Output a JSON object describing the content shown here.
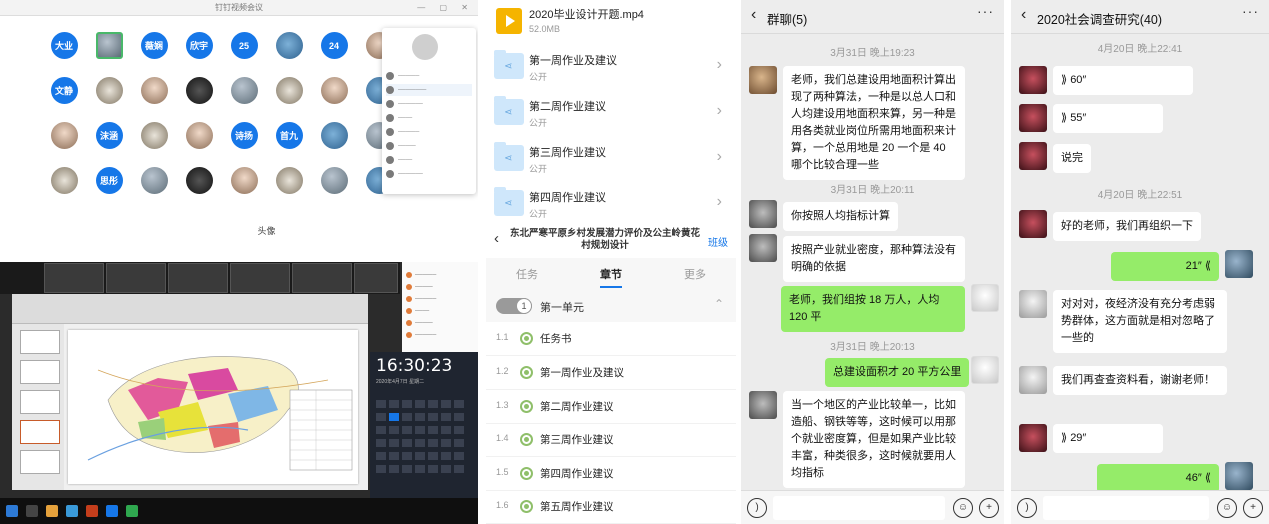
{
  "meeting": {
    "window_title": "钉钉视频会议",
    "attendees": [
      {
        "label": "大业",
        "type": "blue"
      },
      {
        "label": "",
        "type": "pic"
      },
      {
        "label": "薇娴",
        "type": "blue"
      },
      {
        "label": "欣宇",
        "type": "blue"
      },
      {
        "label": "25",
        "type": "blue"
      },
      {
        "label": "",
        "type": "pic3"
      },
      {
        "label": "24",
        "type": "blue"
      },
      {
        "label": "",
        "type": "pic2"
      },
      {
        "label": "文静",
        "type": "blue"
      },
      {
        "label": "",
        "type": "pic4"
      },
      {
        "label": "",
        "type": "pic2"
      },
      {
        "label": "",
        "type": "pic5"
      },
      {
        "label": "",
        "type": "pic"
      },
      {
        "label": "",
        "type": "pic4"
      },
      {
        "label": "",
        "type": "pic2"
      },
      {
        "label": "",
        "type": "pic3"
      },
      {
        "label": "",
        "type": "pic2"
      },
      {
        "label": "沫涵",
        "type": "blue"
      },
      {
        "label": "",
        "type": "pic4"
      },
      {
        "label": "",
        "type": "pic2"
      },
      {
        "label": "诗扬",
        "type": "blue"
      },
      {
        "label": "首九",
        "type": "blue"
      },
      {
        "label": "",
        "type": "pic3"
      },
      {
        "label": "",
        "type": "pic"
      },
      {
        "label": "",
        "type": "pic4"
      },
      {
        "label": "思彤",
        "type": "blue"
      },
      {
        "label": "",
        "type": "pic"
      },
      {
        "label": "",
        "type": "pic5"
      },
      {
        "label": "",
        "type": "pic2"
      },
      {
        "label": "",
        "type": "pic4"
      },
      {
        "label": "",
        "type": "pic"
      },
      {
        "label": "",
        "type": "pic3"
      },
      {
        "label": "头像",
        "type": "none"
      }
    ],
    "clock_time": "16:30:23",
    "clock_date": "2020年4月7日 星期二"
  },
  "course": {
    "video": {
      "name": "2020毕业设计开题.mp4",
      "size": "52.0MB"
    },
    "folders": [
      {
        "name": "第一周作业及建议",
        "status": "公开"
      },
      {
        "name": "第二周作业建议",
        "status": "公开"
      },
      {
        "name": "第三周作业建议",
        "status": "公开"
      },
      {
        "name": "第四周作业建议",
        "status": "公开"
      }
    ],
    "title": "东北严寒平原乡村发展潜力评价及公主岭黄花村规划设计",
    "class_button": "班级",
    "tabs": [
      "任务",
      "章节",
      "更多"
    ],
    "unit_number": "1",
    "unit_label": "第一单元",
    "chapters": [
      {
        "num": "1.1",
        "label": "任务书"
      },
      {
        "num": "1.2",
        "label": "第一周作业及建议"
      },
      {
        "num": "1.3",
        "label": "第二周作业建议"
      },
      {
        "num": "1.4",
        "label": "第三周作业建议"
      },
      {
        "num": "1.5",
        "label": "第四周作业建议"
      },
      {
        "num": "1.6",
        "label": "第五周作业建议"
      }
    ]
  },
  "chat1": {
    "title": "群聊(5)",
    "ts1": "3月31日 晚上19:23",
    "m1": "老师，我们总建设用地面积计算出现了两种算法，一种是以总人口和人均建设用地面积来算，另一种是用各类就业岗位所需用地面积来计算，一个总用地是 20 一个是 40 哪个比较合理一些",
    "ts2": "3月31日 晚上20:11",
    "m2": "你按照人均指标计算",
    "m3": "按照产业就业密度，那种算法没有明确的依据",
    "m4": "老师，我们组按 18 万人，人均 120 平",
    "ts3": "3月31日 晚上20:13",
    "m5": "总建设面积才 20 平方公里",
    "m6": "当一个地区的产业比较单一，比如造船、钢铁等等，这时候可以用那个就业密度算，但是如果产业比较丰富，种类很多，这时候就要用人均指标"
  },
  "chat2": {
    "title": "2020社会调查研究(40)",
    "ts1": "4月20日 晚上22:41",
    "v1": "60″",
    "v2": "55″",
    "m1": "说完",
    "ts2": "4月20日 晚上22:51",
    "m2": "好的老师，我们再组织一下",
    "v3": "21″",
    "m3": "对对对，夜经济没有充分考虑弱势群体，这方面就是相对忽略了一些的",
    "m4": "我们再查查资料看，谢谢老师！",
    "v4": "29″",
    "v5": "46″"
  },
  "colors": {
    "accent_blue": "#1677e8",
    "wechat_green": "#95ec69",
    "check_green": "#8fbf6a"
  }
}
